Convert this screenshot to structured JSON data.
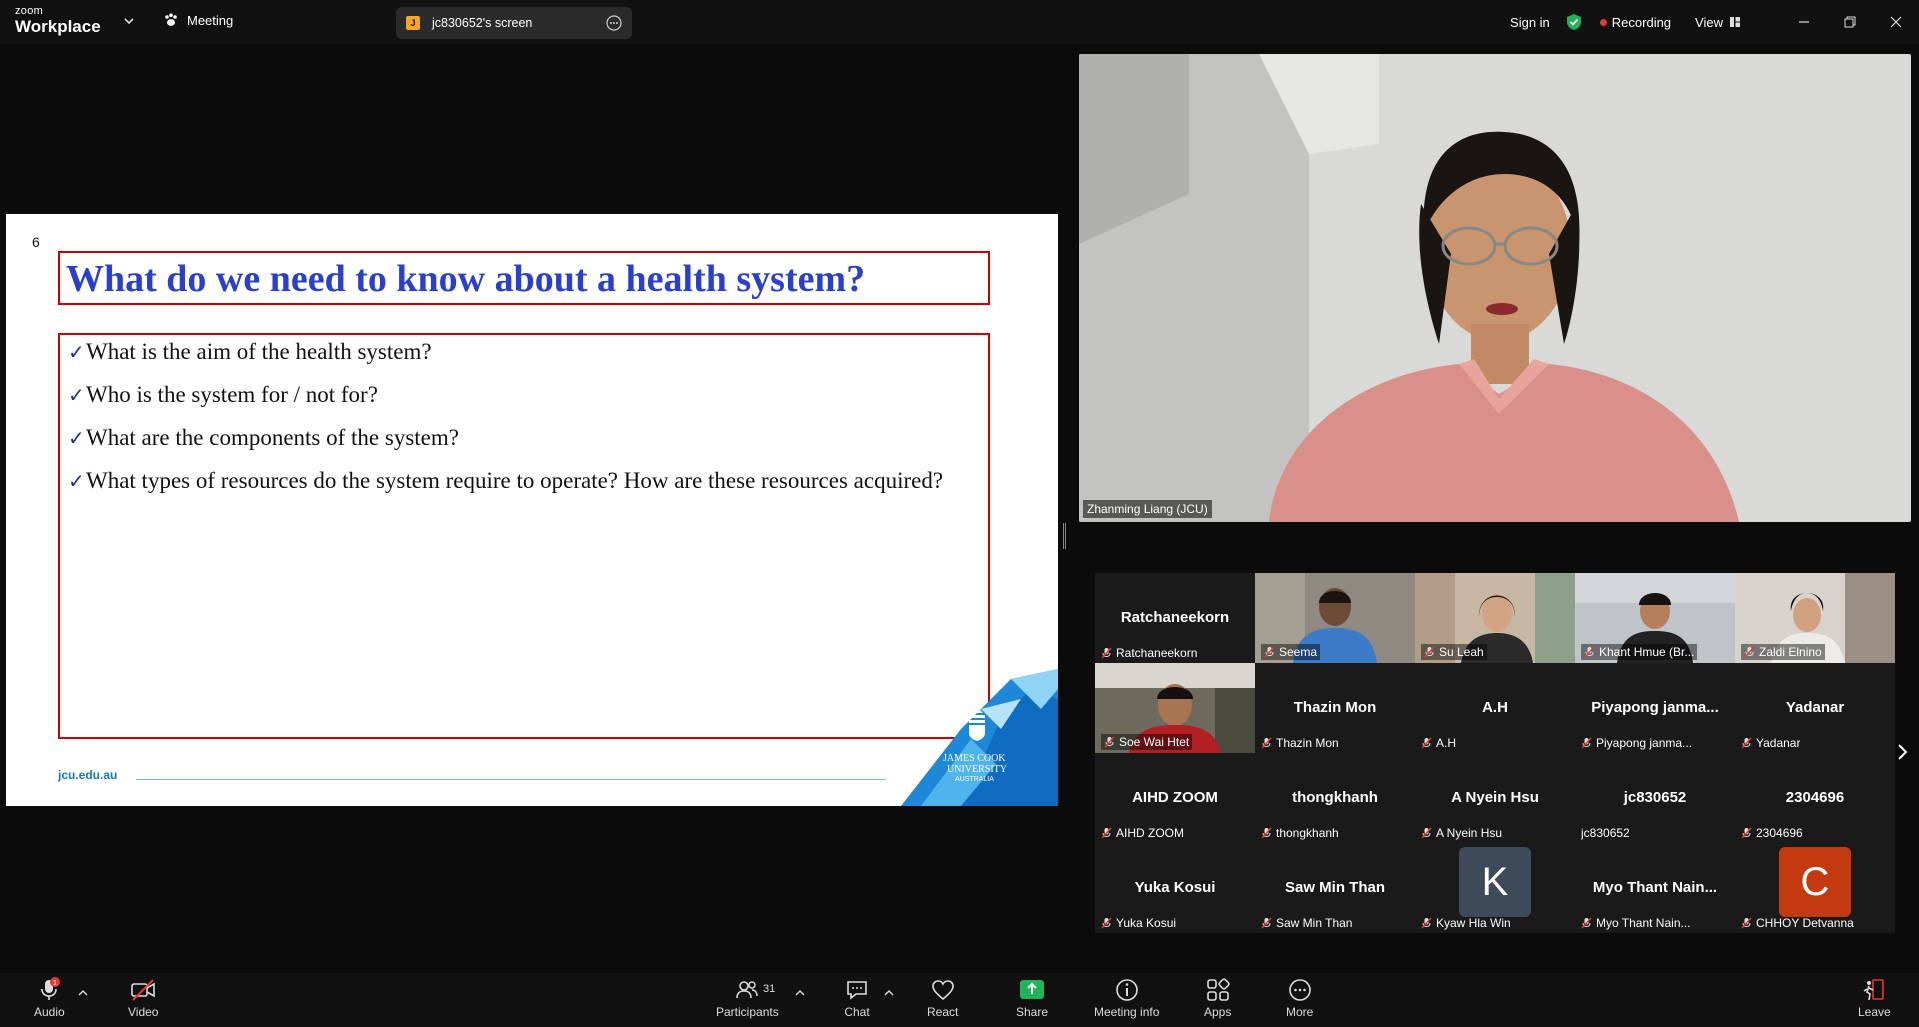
{
  "titlebar": {
    "logo_top": "zoom",
    "logo_bottom": "Workplace",
    "meeting_label": "Meeting",
    "screen_badge": "J",
    "screen_label": "jc830652's screen",
    "sign_in": "Sign in",
    "recording": "Recording",
    "view": "View",
    "accent_green": "#1fb35a",
    "recording_color": "#e53935"
  },
  "slide": {
    "number": "6",
    "title": "What do we need to know about a health system?",
    "bullets": [
      "What is the aim of the health system?",
      "Who is the system for / not for?",
      "What are the components of the system?",
      "What types of resources do the system require to operate? How are these resources acquired?"
    ],
    "footer": "jcu.edu.au",
    "logo_line1": "JAMES COOK",
    "logo_line2": "UNIVERSITY",
    "logo_line3": "AUSTRALIA",
    "title_color": "#2a3fd1",
    "box_color": "#cc0000"
  },
  "speaker": {
    "name": "Zhanming Liang (JCU)"
  },
  "gallery": {
    "tiles": [
      {
        "big": "Ratchaneekorn",
        "name": "Ratchaneekorn",
        "kind": "text",
        "muted": true
      },
      {
        "big": "",
        "name": "Seema",
        "kind": "video",
        "muted": true
      },
      {
        "big": "",
        "name": "Su Leah",
        "kind": "video",
        "muted": true
      },
      {
        "big": "",
        "name": "Khant Hmue (Br...",
        "kind": "video",
        "muted": true
      },
      {
        "big": "",
        "name": "Zaldi Elnino",
        "kind": "video",
        "muted": true
      },
      {
        "big": "",
        "name": "Soe Wai Htet",
        "kind": "video",
        "muted": true
      },
      {
        "big": "Thazin Mon",
        "name": "Thazin Mon",
        "kind": "text",
        "muted": true
      },
      {
        "big": "A.H",
        "name": "A.H",
        "kind": "text",
        "muted": true
      },
      {
        "big": "Piyapong  janma...",
        "name": "Piyapong janma...",
        "kind": "text",
        "muted": true
      },
      {
        "big": "Yadanar",
        "name": "Yadanar",
        "kind": "text",
        "muted": true
      },
      {
        "big": "AIHD ZOOM",
        "name": "AIHD ZOOM",
        "kind": "text",
        "muted": true
      },
      {
        "big": "thongkhanh",
        "name": "thongkhanh",
        "kind": "text",
        "muted": true
      },
      {
        "big": "A Nyein Hsu",
        "name": "A Nyein Hsu",
        "kind": "text",
        "muted": true
      },
      {
        "big": "jc830652",
        "name": "jc830652",
        "kind": "text",
        "muted": false
      },
      {
        "big": "2304696",
        "name": "2304696",
        "kind": "text",
        "muted": true
      },
      {
        "big": "Yuka Kosui",
        "name": "Yuka Kosui",
        "kind": "text",
        "muted": true
      },
      {
        "big": "Saw Min Than",
        "name": "Saw Min Than",
        "kind": "text",
        "muted": true
      },
      {
        "big": "K",
        "name": "Kyaw Hla Win",
        "kind": "avatar-k",
        "muted": true
      },
      {
        "big": "Myo  Thant  Nain...",
        "name": "Myo Thant Nain...",
        "kind": "text",
        "muted": true
      },
      {
        "big": "C",
        "name": "CHHOY Detvanna",
        "kind": "avatar-c",
        "muted": true
      }
    ]
  },
  "toolbar": {
    "audio": "Audio",
    "audio_badge": "1",
    "video": "Video",
    "participants": "Participants",
    "participants_count": "31",
    "chat": "Chat",
    "react": "React",
    "share": "Share",
    "meeting_info": "Meeting info",
    "apps": "Apps",
    "more": "More",
    "leave": "Leave",
    "share_color": "#1fb35a",
    "leave_color": "#e53935"
  }
}
